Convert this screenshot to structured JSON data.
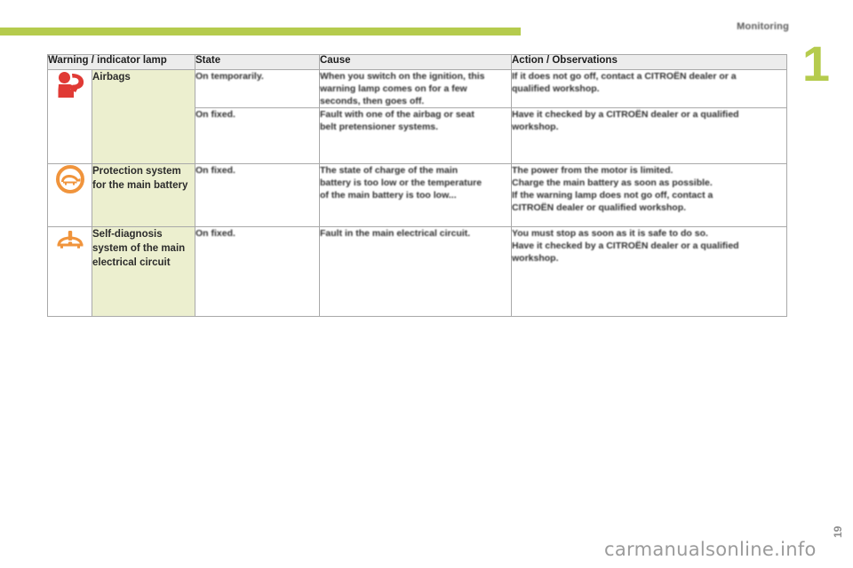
{
  "header": {
    "chapter_title": "Monitoring",
    "chapter_number": "1"
  },
  "table": {
    "columns": [
      "Warning / indicator lamp",
      "State",
      "Cause",
      "Action / Observations"
    ],
    "rows": [
      {
        "icon": "airbag-warning-icon",
        "icon_color": "#e03a35",
        "name": "Airbags",
        "states": [
          {
            "state": "On temporarily.",
            "cause": [
              "When you switch on the ignition, this",
              "warning lamp comes on for a few",
              "seconds, then goes off."
            ],
            "action": [
              "If it does not go off, contact a CITROËN dealer or a",
              "qualified workshop."
            ]
          },
          {
            "state": "On fixed.",
            "cause": [
              "Fault with one of the airbag or seat",
              "belt pretensioner systems."
            ],
            "action": [
              "Have it checked by a CITROËN dealer or a qualified",
              "workshop."
            ]
          }
        ]
      },
      {
        "icon": "turtle-battery-protection-icon",
        "icon_color": "#f0943c",
        "name": "Protection system for the main battery",
        "states": [
          {
            "state": "On fixed.",
            "cause": [
              "The state of charge of the main",
              "battery is too low or the temperature",
              "of the main battery is too low..."
            ],
            "action": [
              "The power from the motor is limited.",
              "Charge the main battery as soon as possible.",
              "If the warning lamp does not go off, contact a",
              "CITROËN dealer or qualified workshop."
            ]
          }
        ]
      },
      {
        "icon": "car-self-diagnosis-icon",
        "icon_color": "#f0943c",
        "name": "Self-diagnosis system of the main electrical circuit",
        "states": [
          {
            "state": "On fixed.",
            "cause": [
              "Fault in the main electrical circuit."
            ],
            "action": [
              "You must stop as soon as it is safe to do so.",
              "Have it checked by a CITROËN dealer or a qualified",
              "workshop."
            ]
          }
        ]
      }
    ]
  },
  "footer": {
    "watermark": "carmanualsonline.info",
    "page_number": "19"
  },
  "colors": {
    "accent_green": "#b5cb4d",
    "name_cell_bg": "#ecefcf",
    "header_bg": "#ececec",
    "border": "#a9a9a9"
  }
}
